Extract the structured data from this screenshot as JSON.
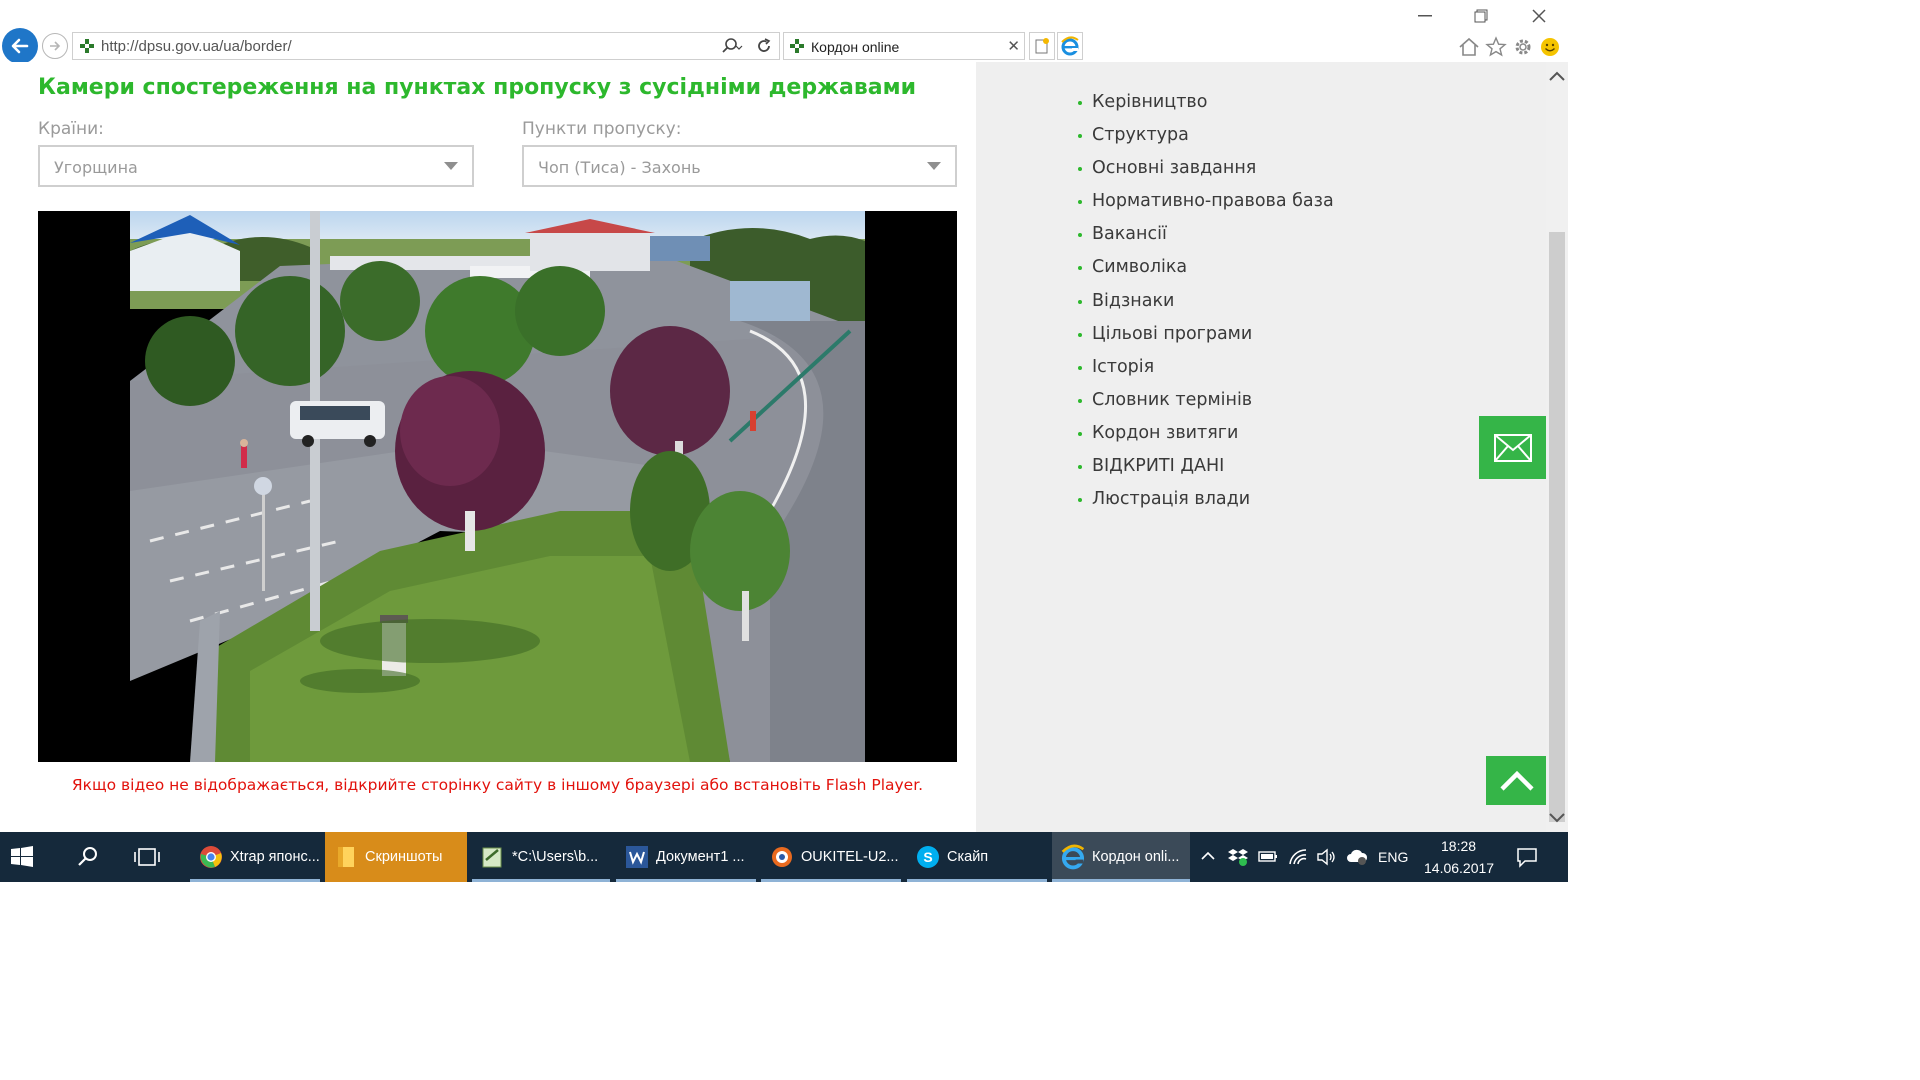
{
  "browser": {
    "url": "http://dpsu.gov.ua/ua/border/",
    "tab_title": "Кордон online"
  },
  "page": {
    "title": "Камери спостереження на пунктах пропуску з сусідніми державами",
    "countries_label": "Країни:",
    "countries_value": "Угорщина",
    "checkpoints_label": "Пункти пропуску:",
    "checkpoints_value": "Чоп (Тиса) - Захонь",
    "video_notice": "Якщо відео не відображається, відкрийте сторінку сайту в іншому браузері або встановіть Flash Player."
  },
  "sidebar": {
    "menu": [
      "Керівництво",
      "Структура",
      "Основні завдання",
      "Нормативно-правова база",
      "Вакансії",
      "Символіка",
      "Відзнаки",
      "Цільові програми",
      "Історія",
      "Словник термінів",
      "Кордон звитяги",
      "ВІДКРИТІ ДАНІ",
      "Люстрація влади"
    ]
  },
  "taskbar": {
    "apps": [
      {
        "label": "Xtrap японс...",
        "icon": "chrome-icon"
      },
      {
        "label": "Скриншоты",
        "icon": "folder-icon"
      },
      {
        "label": "*C:\\Users\\b...",
        "icon": "notepad-icon"
      },
      {
        "label": "Документ1 ...",
        "icon": "word-icon"
      },
      {
        "label": "OUKITEL-U2...",
        "icon": "app-icon"
      },
      {
        "label": "Скайп",
        "icon": "skype-icon"
      },
      {
        "label": "Кордон onli...",
        "icon": "ie-icon"
      }
    ],
    "language": "ENG",
    "time": "18:28",
    "date": "14.06.2017"
  },
  "colors": {
    "accent_green": "#2db82d",
    "button_green": "#35b548",
    "notice_red": "#e2120c",
    "taskbar": "#15293b"
  }
}
